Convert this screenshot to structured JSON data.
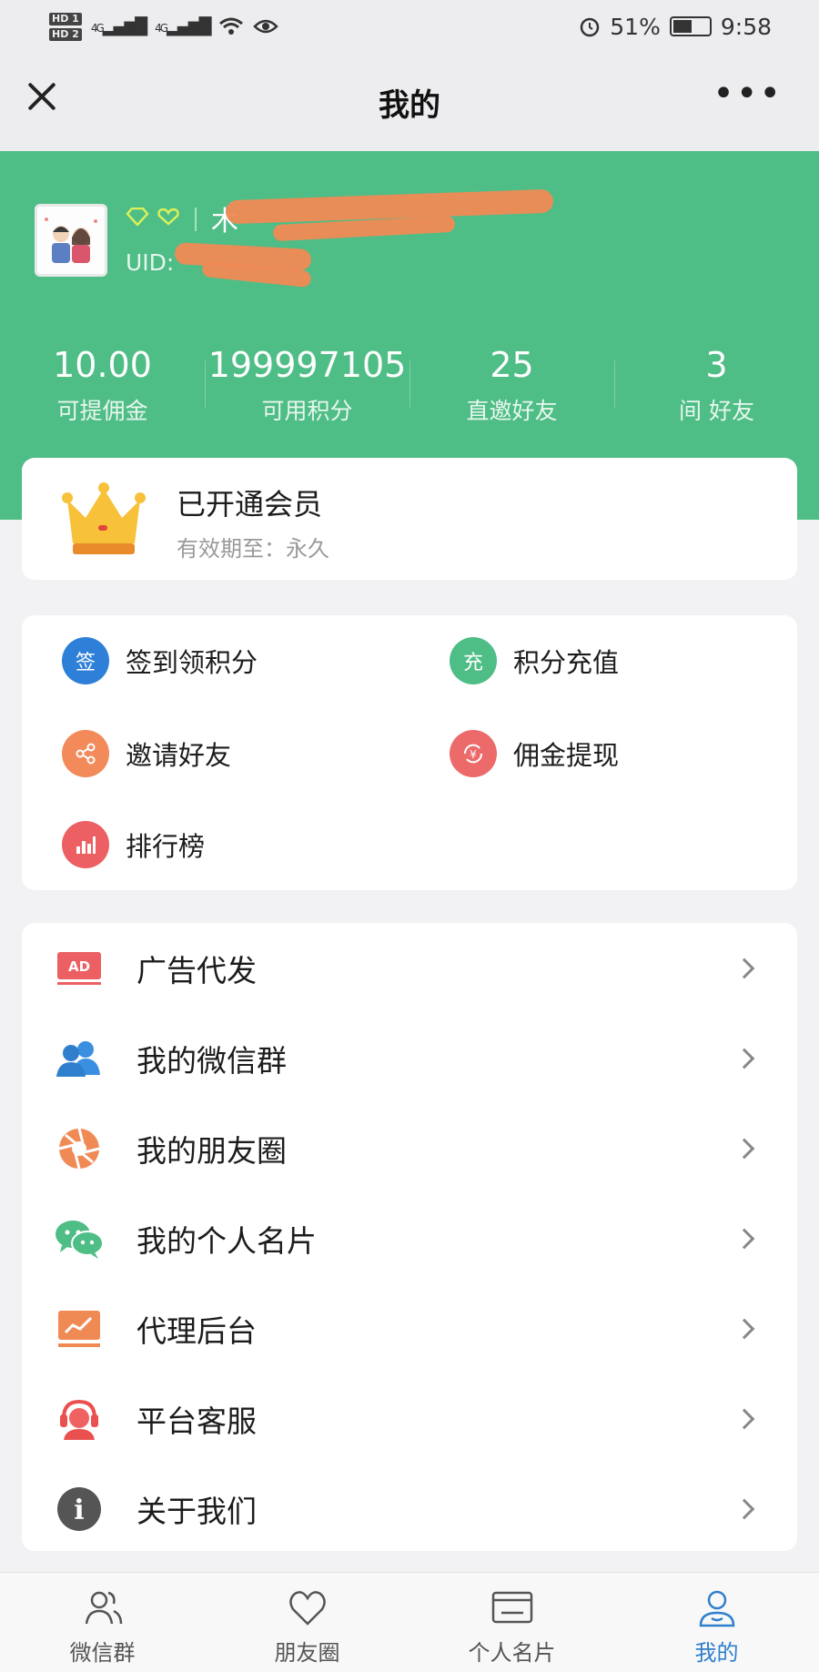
{
  "status_bar": {
    "hd1": "HD 1",
    "hd2": "HD 2",
    "signal1": "4G",
    "signal2": "4G",
    "battery": "51%",
    "time": "9:58"
  },
  "nav": {
    "title": "我的"
  },
  "profile": {
    "nickname": "木",
    "uid_label": "UID:"
  },
  "stats": [
    {
      "value": "10.00",
      "label": "可提佣金"
    },
    {
      "value": "199997105",
      "label": "可用积分"
    },
    {
      "value": "25",
      "label": "直邀好友"
    },
    {
      "value": "3",
      "label": "间    好友"
    }
  ],
  "member": {
    "title": "已开通会员",
    "subtitle": "有效期至：永久"
  },
  "quick_actions": [
    {
      "icon_text": "签",
      "label": "签到领积分",
      "color": "#2e7fd8"
    },
    {
      "icon_text": "充",
      "label": "积分充值",
      "color": "#4fbd86"
    },
    {
      "icon_text": "",
      "label": "邀请好友",
      "color": "#f28a5a"
    },
    {
      "icon_text": "",
      "label": "佣金提现",
      "color": "#ec6a6a"
    },
    {
      "icon_text": "",
      "label": "排行榜",
      "color": "#ec5f63"
    }
  ],
  "menu": [
    {
      "label": "广告代发",
      "icon": "ad-icon",
      "icon_text": "AD"
    },
    {
      "label": "我的微信群",
      "icon": "group-icon"
    },
    {
      "label": "我的朋友圈",
      "icon": "aperture-icon"
    },
    {
      "label": "我的个人名片",
      "icon": "wechat-icon"
    },
    {
      "label": "代理后台",
      "icon": "chart-board-icon"
    },
    {
      "label": "平台客服",
      "icon": "headset-icon"
    },
    {
      "label": "关于我们",
      "icon": "info-icon",
      "icon_text": "i"
    }
  ],
  "tabs": [
    {
      "label": "微信群"
    },
    {
      "label": "朋友圈"
    },
    {
      "label": "个人名片"
    },
    {
      "label": "我的"
    }
  ],
  "colors": {
    "brand_green": "#4fbd86",
    "active_tab": "#2f7fcc"
  }
}
